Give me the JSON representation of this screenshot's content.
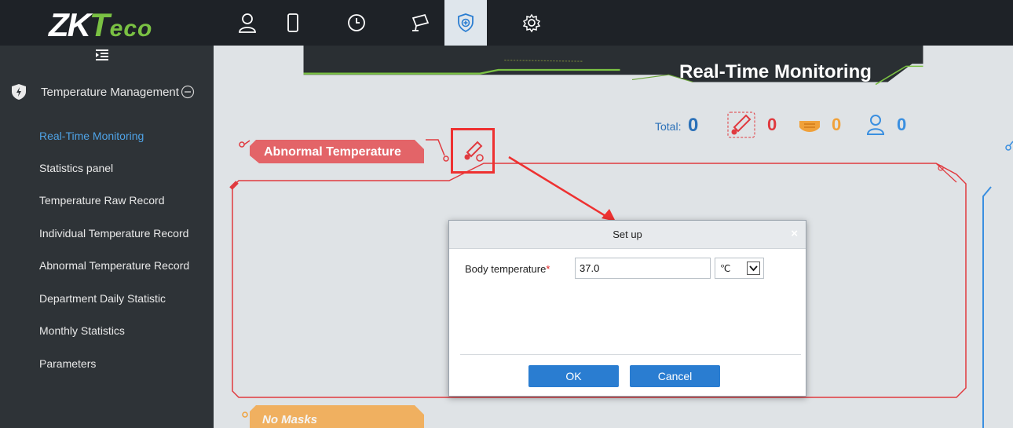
{
  "app": {
    "logo_text": "ZKTeco",
    "accent_color": "#7ac143"
  },
  "topnav": {
    "items": [
      {
        "icon": "person-icon",
        "label": "Personnel"
      },
      {
        "icon": "door-icon",
        "label": "Access"
      },
      {
        "icon": "clock-icon",
        "label": "Attendance"
      },
      {
        "icon": "camera-icon",
        "label": "Video"
      },
      {
        "icon": "shield-plus-icon",
        "label": "Temperature",
        "active": true
      },
      {
        "icon": "gear-icon",
        "label": "System"
      }
    ]
  },
  "sidebar": {
    "group_title": "Temperature Management",
    "items": [
      {
        "label": "Real-Time Monitoring",
        "active": true
      },
      {
        "label": "Statistics panel"
      },
      {
        "label": "Temperature Raw Record"
      },
      {
        "label": "Individual Temperature Record"
      },
      {
        "label": "Abnormal Temperature Record"
      },
      {
        "label": "Department Daily Statistic"
      },
      {
        "label": "Monthly Statistics"
      },
      {
        "label": "Parameters"
      }
    ]
  },
  "main": {
    "title": "Real-Time Monitoring",
    "total_label": "Total:",
    "total_value": "0",
    "counts": {
      "abnormal_temperature": "0",
      "no_mask": "0",
      "persons": "0"
    },
    "panels": {
      "abnormal_title": "Abnormal Temperature",
      "no_mask_title": "No Masks"
    },
    "colors": {
      "abnormal": "#e03a3f",
      "no_mask": "#f0a13a",
      "persons": "#3a8fe0"
    }
  },
  "dialog": {
    "title": "Set up",
    "close_symbol": "×",
    "field_label": "Body temperature",
    "required_mark": "*",
    "field_value": "37.0",
    "unit_value": "℃",
    "ok_label": "OK",
    "cancel_label": "Cancel"
  }
}
